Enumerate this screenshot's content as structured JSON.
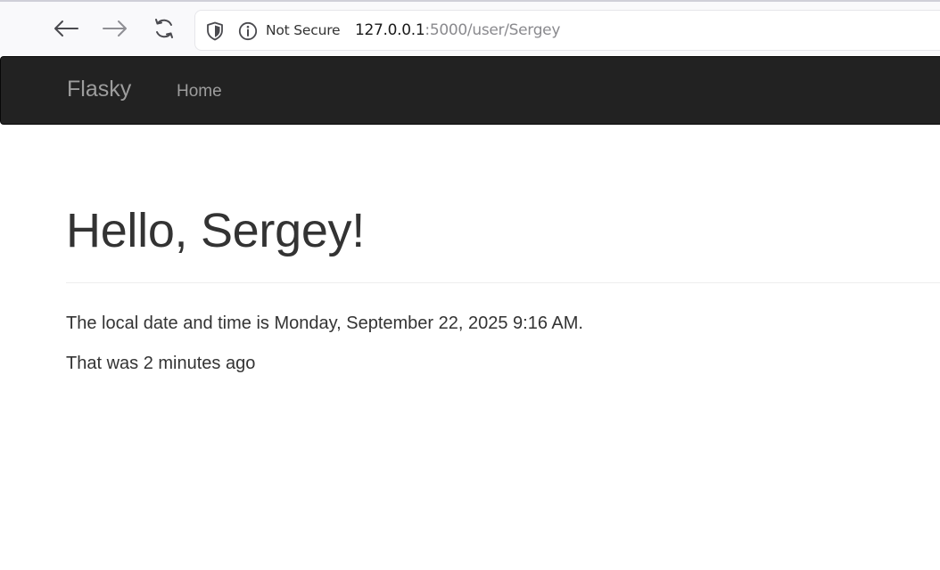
{
  "browser": {
    "security_label": "Not Secure",
    "url_host": "127.0.0.1",
    "url_rest": ":5000/user/Sergey"
  },
  "navbar": {
    "brand": "Flasky",
    "items": [
      {
        "label": "Home"
      }
    ],
    "background": "#222222",
    "link_color": "#9d9d9d"
  },
  "main": {
    "heading": "Hello, Sergey!",
    "local_time_text": "The local date and time is Monday, September 22, 2025 9:16 AM.",
    "relative_time_text": "That was 2 minutes ago"
  },
  "icons": {
    "back": "arrow-left-icon",
    "forward": "arrow-right-icon",
    "reload": "reload-icon",
    "shield": "shield-icon",
    "info": "info-icon"
  }
}
